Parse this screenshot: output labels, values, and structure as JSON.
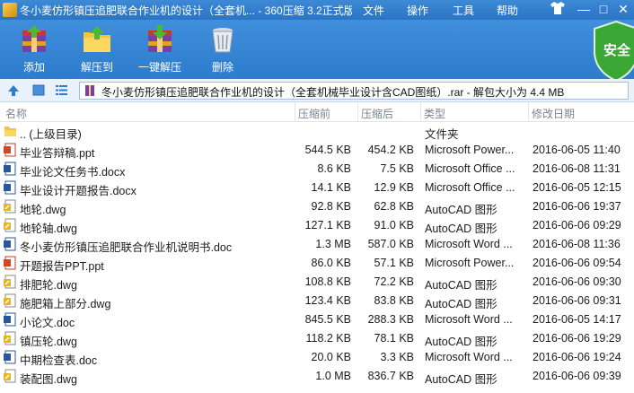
{
  "window": {
    "title": "冬小麦仿形镇压追肥联合作业机的设计（全套机... - 360压缩 3.2正式版",
    "menu": [
      "文件",
      "操作",
      "工具",
      "帮助"
    ],
    "controls": [
      "—",
      "□",
      "✕"
    ]
  },
  "toolbar": {
    "buttons": [
      {
        "label": "添加",
        "icon": "add-archive-icon"
      },
      {
        "label": "解压到",
        "icon": "extract-to-icon"
      },
      {
        "label": "一键解压",
        "icon": "one-click-extract-icon"
      },
      {
        "label": "删除",
        "icon": "delete-trash-icon"
      }
    ],
    "safe_badge": "安全"
  },
  "address": {
    "path": "冬小麦仿形镇压追肥联合作业机的设计（全套机械毕业设计含CAD图纸）.rar - 解包大小为 4.4 MB"
  },
  "columns": {
    "name": "名称",
    "size": "压缩前",
    "packed": "压缩后",
    "type": "类型",
    "modified": "修改日期"
  },
  "files": [
    {
      "name": ".. (上级目录)",
      "size": "",
      "packed": "",
      "type": "文件夹",
      "date": "",
      "icon": "folder-icon"
    },
    {
      "name": "毕业答辩稿.ppt",
      "size": "544.5 KB",
      "packed": "454.2 KB",
      "type": "Microsoft Power...",
      "date": "2016-06-05 11:40",
      "icon": "ppt-file-icon"
    },
    {
      "name": "毕业论文任务书.docx",
      "size": "8.6 KB",
      "packed": "7.5 KB",
      "type": "Microsoft Office ...",
      "date": "2016-06-08 11:31",
      "icon": "docx-file-icon"
    },
    {
      "name": "毕业设计开题报告.docx",
      "size": "14.1 KB",
      "packed": "12.9 KB",
      "type": "Microsoft Office ...",
      "date": "2016-06-05 12:15",
      "icon": "docx-file-icon"
    },
    {
      "name": "地轮.dwg",
      "size": "92.8 KB",
      "packed": "62.8 KB",
      "type": "AutoCAD 图形",
      "date": "2016-06-06 19:37",
      "icon": "dwg-file-icon"
    },
    {
      "name": "地轮轴.dwg",
      "size": "127.1 KB",
      "packed": "91.0 KB",
      "type": "AutoCAD 图形",
      "date": "2016-06-06 09:29",
      "icon": "dwg-file-icon"
    },
    {
      "name": "冬小麦仿形镇压追肥联合作业机说明书.doc",
      "size": "1.3 MB",
      "packed": "587.0 KB",
      "type": "Microsoft Word ...",
      "date": "2016-06-08 11:36",
      "icon": "doc-file-icon"
    },
    {
      "name": "开题报告PPT.ppt",
      "size": "86.0 KB",
      "packed": "57.1 KB",
      "type": "Microsoft Power...",
      "date": "2016-06-06 09:54",
      "icon": "ppt-file-icon"
    },
    {
      "name": "排肥轮.dwg",
      "size": "108.8 KB",
      "packed": "72.2 KB",
      "type": "AutoCAD 图形",
      "date": "2016-06-06 09:30",
      "icon": "dwg-file-icon"
    },
    {
      "name": "施肥箱上部分.dwg",
      "size": "123.4 KB",
      "packed": "83.8 KB",
      "type": "AutoCAD 图形",
      "date": "2016-06-06 09:31",
      "icon": "dwg-file-icon"
    },
    {
      "name": "小论文.doc",
      "size": "845.5 KB",
      "packed": "288.3 KB",
      "type": "Microsoft Word ...",
      "date": "2016-06-05 14:17",
      "icon": "doc-file-icon"
    },
    {
      "name": "镇压轮.dwg",
      "size": "118.2 KB",
      "packed": "78.1 KB",
      "type": "AutoCAD 图形",
      "date": "2016-06-06 19:29",
      "icon": "dwg-file-icon"
    },
    {
      "name": "中期检查表.doc",
      "size": "20.0 KB",
      "packed": "3.3 KB",
      "type": "Microsoft Word ...",
      "date": "2016-06-06 19:24",
      "icon": "doc-file-icon"
    },
    {
      "name": "装配图.dwg",
      "size": "1.0 MB",
      "packed": "836.7 KB",
      "type": "AutoCAD 图形",
      "date": "2016-06-06 09:39",
      "icon": "dwg-file-icon"
    }
  ],
  "colors": {
    "titlebar": "#2a74c4",
    "toolbar": "#3f8fdc",
    "safe_green": "#3aa634"
  }
}
